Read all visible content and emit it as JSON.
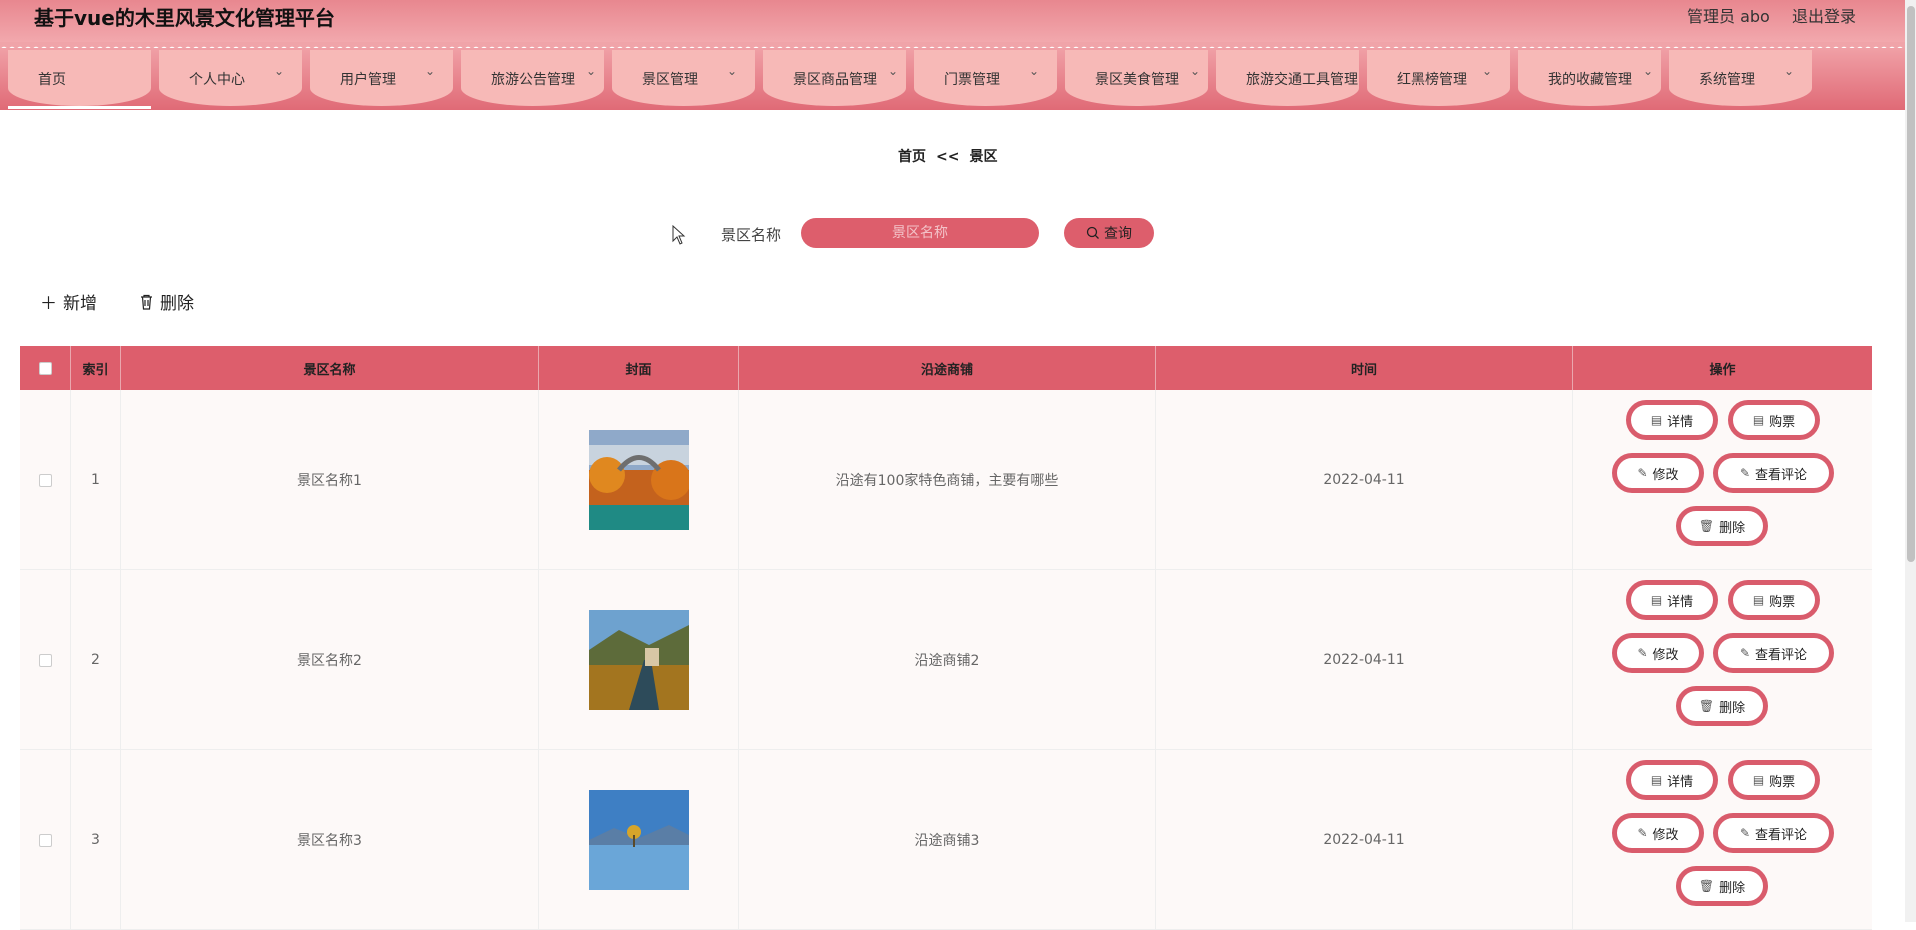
{
  "header": {
    "title": "基于vue的木里风景文化管理平台",
    "admin": "管理员 abo",
    "logout": "退出登录"
  },
  "nav": [
    {
      "label": "首页"
    },
    {
      "label": "个人中心"
    },
    {
      "label": "用户管理"
    },
    {
      "label": "旅游公告管理"
    },
    {
      "label": "景区管理"
    },
    {
      "label": "景区商品管理"
    },
    {
      "label": "门票管理"
    },
    {
      "label": "景区美食管理"
    },
    {
      "label": "旅游交通工具管理"
    },
    {
      "label": "红黑榜管理"
    },
    {
      "label": "我的收藏管理"
    },
    {
      "label": "系统管理"
    }
  ],
  "breadcrumb": {
    "home": "首页",
    "sep": "<<",
    "current": "景区"
  },
  "search": {
    "label": "景区名称",
    "placeholder": "景区名称",
    "button": "查询"
  },
  "toolbar": {
    "add": "新增",
    "delete": "删除"
  },
  "table": {
    "headers": [
      "索引",
      "景区名称",
      "封面",
      "沿途商铺",
      "时间",
      "操作"
    ],
    "rows": [
      {
        "index": "1",
        "name": "景区名称1",
        "shops": "沿途有100家特色商铺，主要有哪些",
        "time": "2022-04-11"
      },
      {
        "index": "2",
        "name": "景区名称2",
        "shops": "沿途商铺2",
        "time": "2022-04-11"
      },
      {
        "index": "3",
        "name": "景区名称3",
        "shops": "沿途商铺3",
        "time": "2022-04-11"
      }
    ],
    "actions": {
      "detail": "详情",
      "buy": "购票",
      "edit": "修改",
      "comments": "查看评论",
      "delete": "删除"
    }
  },
  "colors": {
    "accent": "#dd5e6c",
    "nav_item": "#f7b9b7"
  }
}
